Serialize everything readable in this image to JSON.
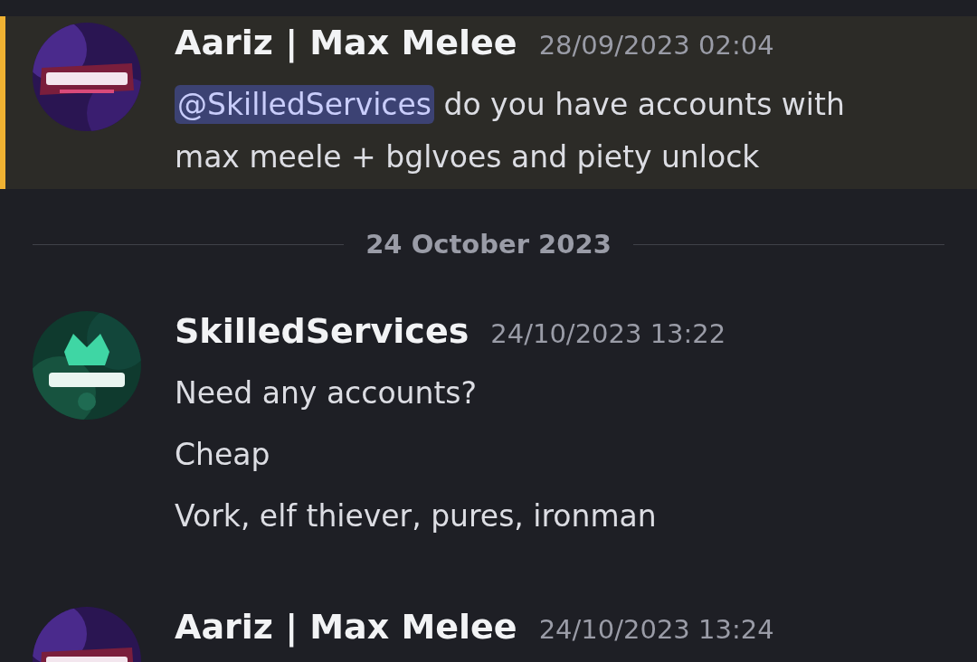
{
  "feed": [
    {
      "kind": "message",
      "highlighted": true,
      "avatar": {
        "kind": "picture",
        "color": "#2a1552"
      },
      "author": "Aariz | Max Melee",
      "timestamp": "28/09/2023 02:04",
      "paragraphs": [
        {
          "mention": "@SkilledServices",
          "text": "do you have accounts with max meele + bglvoes and piety unlock"
        }
      ]
    },
    {
      "kind": "divider",
      "label": "24 October 2023"
    },
    {
      "kind": "message",
      "highlighted": false,
      "avatar": {
        "kind": "picture",
        "color": "#0f3a2e"
      },
      "author": "SkilledServices",
      "timestamp": "24/10/2023 13:22",
      "paragraphs": [
        {
          "text": "Need any accounts?"
        },
        {
          "text": "Cheap"
        },
        {
          "text": "Vork, elf thiever, pures, ironman"
        }
      ]
    },
    {
      "kind": "message",
      "highlighted": false,
      "avatar": {
        "kind": "picture",
        "color": "#2a1552"
      },
      "author": "Aariz | Max Melee",
      "timestamp": "24/10/2023 13:24"
    }
  ]
}
